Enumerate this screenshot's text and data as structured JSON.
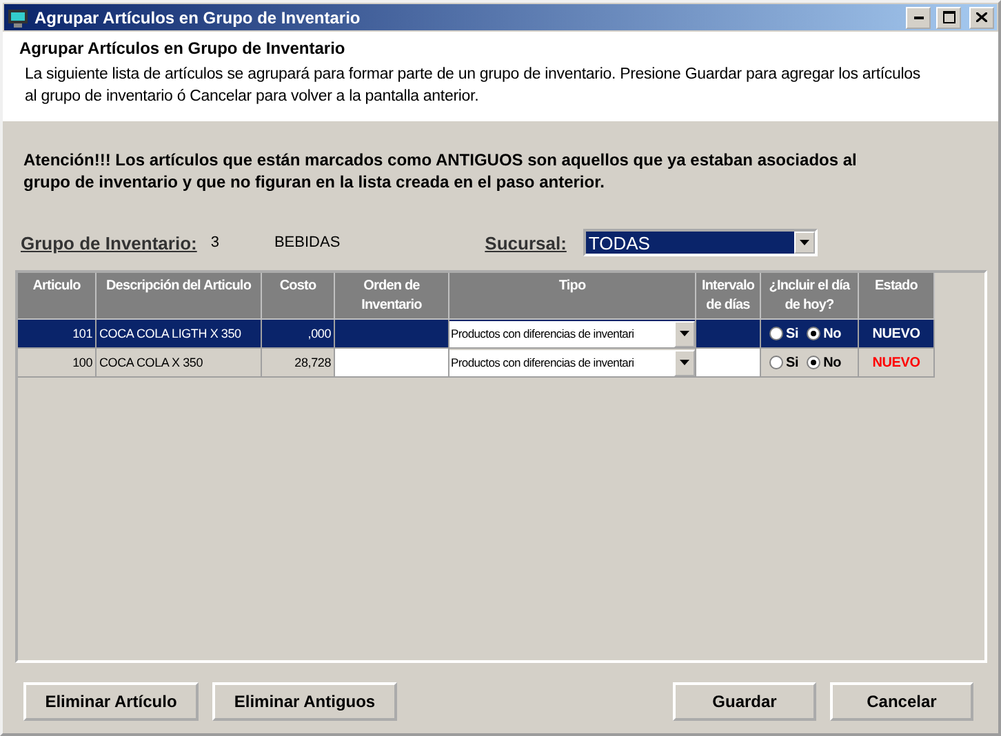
{
  "window": {
    "title": "Agrupar Artículos en Grupo de Inventario"
  },
  "header": {
    "title": "Agrupar Artículos en Grupo de Inventario",
    "description": "La siguiente lista de artículos se agrupará para formar parte de un grupo de inventario. Presione Guardar para agregar los artículos al grupo de inventario ó Cancelar para volver a la pantalla anterior."
  },
  "notice": "Atención!!! Los artículos que están marcados como ANTIGUOS son aquellos que ya estaban asociados al grupo de inventario y que no figuran en la lista creada en el paso anterior.",
  "group": {
    "label": "Grupo de Inventario:",
    "code": "3",
    "name": "BEBIDAS"
  },
  "branch": {
    "label": "Sucursal:",
    "value": "TODAS"
  },
  "table": {
    "columns": [
      "Articulo",
      "Descripción del Articulo",
      "Costo",
      "Orden de Inventario",
      "Tipo",
      "Intervalo de días",
      "¿Incluir el día de hoy?",
      "Estado"
    ],
    "rows": [
      {
        "selected": true,
        "articulo": "101",
        "descripcion": "COCA COLA LIGTH X 350",
        "costo": ",000",
        "tipo": "Productos con diferencias de inventari",
        "incluir": [
          {
            "label": "Si",
            "selected": false
          },
          {
            "label": "No",
            "selected": true
          }
        ],
        "estado": "NUEVO",
        "color": "#ffffff"
      },
      {
        "selected": false,
        "articulo": "100",
        "descripcion": "COCA COLA X 350",
        "costo": "28,728",
        "tipo": "Productos con diferencias de inventari",
        "incluir": [
          {
            "label": "Si",
            "selected": false
          },
          {
            "label": "No",
            "selected": true
          }
        ],
        "estado": "NUEVO",
        "color": "#ff0000"
      }
    ]
  },
  "buttons": [
    "Eliminar Artículo",
    "Eliminar Antiguos",
    "Guardar",
    "Cancelar"
  ]
}
